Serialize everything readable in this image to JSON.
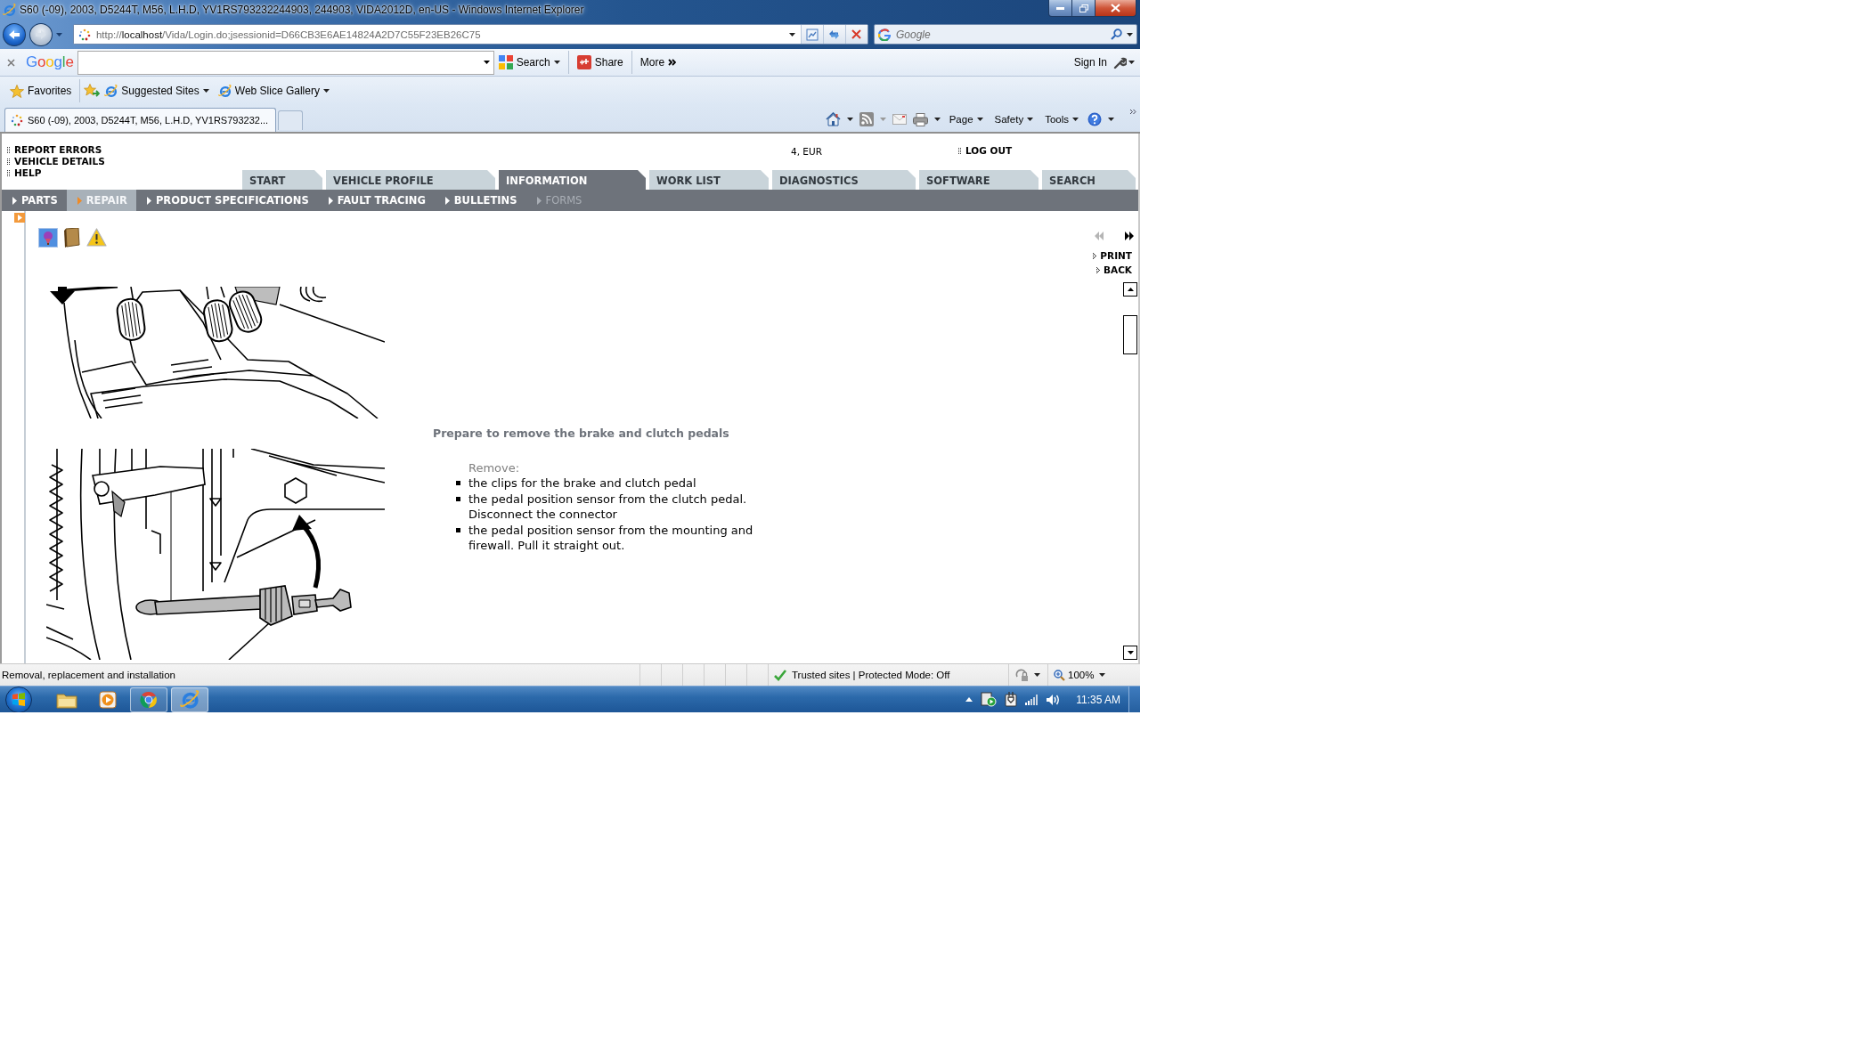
{
  "window": {
    "title": "S60 (-09), 2003, D5244T, M56, L.H.D, YV1RS793232244903, 244903, VIDA2012D, en-US - Windows Internet Explorer"
  },
  "address_bar": {
    "url": "http://**localhost**/Vida/Login.do;jsessionid=D66CB3E6AE14824A2D7C55F23EB26C75"
  },
  "search_box": {
    "placeholder": "Google"
  },
  "google_toolbar": {
    "logo": "Google",
    "buttons": [
      {
        "kind": "search",
        "label": "Search"
      },
      {
        "kind": "share",
        "label": "Share"
      },
      {
        "kind": "more",
        "label": "More"
      }
    ],
    "sign_in": "Sign In"
  },
  "favorites_bar": {
    "favorites": "Favorites",
    "links": [
      "Suggested Sites",
      "Web Slice Gallery"
    ]
  },
  "browser_tabs": [
    {
      "title": "S60 (-09), 2003, D5244T, M56, L.H.D, YV1RS793232...",
      "selected": true
    }
  ],
  "command_bar": {
    "menus": [
      "Page",
      "Safety",
      "Tools"
    ]
  },
  "app": {
    "top_links": [
      "REPORT ERRORS",
      "VEHICLE DETAILS",
      "HELP"
    ],
    "account": "4, EUR",
    "logout": "LOG OUT",
    "tabs": [
      {
        "label": "START",
        "selected": false
      },
      {
        "label": "VEHICLE PROFILE",
        "selected": false
      },
      {
        "label": "INFORMATION",
        "selected": true
      },
      {
        "label": "WORK LIST",
        "selected": false
      },
      {
        "label": "DIAGNOSTICS",
        "selected": false
      },
      {
        "label": "SOFTWARE",
        "selected": false
      },
      {
        "label": "SEARCH",
        "selected": false
      }
    ],
    "sub_tabs": [
      {
        "label": "PARTS",
        "selected": false,
        "disabled": false
      },
      {
        "label": "REPAIR",
        "selected": true,
        "disabled": false
      },
      {
        "label": "PRODUCT SPECIFICATIONS",
        "selected": false,
        "disabled": false
      },
      {
        "label": "FAULT TRACING",
        "selected": false,
        "disabled": false
      },
      {
        "label": "BULLETINS",
        "selected": false,
        "disabled": false
      },
      {
        "label": "FORMS",
        "selected": false,
        "disabled": true
      }
    ],
    "document": {
      "pager": [
        {
          "kind": "previous",
          "disabled": true
        },
        {
          "kind": "next",
          "disabled": false
        }
      ],
      "actions": [
        "PRINT",
        "BACK"
      ],
      "heading": "Prepare to remove the brake and clutch pedals",
      "intro": "Remove:",
      "steps": [
        "the clips for the brake and clutch pedal",
        "the pedal position sensor from the clutch pedal. Disconnect the connector",
        "the pedal position sensor from the mounting and firewall. Pull it straight out."
      ]
    }
  },
  "status_bar": {
    "text": "Removal, replacement and installation",
    "zone": "Trusted sites | Protected Mode: Off",
    "zoom": "100%"
  },
  "taskbar": {
    "apps": [
      {
        "kind": "folder",
        "running": false,
        "selected": false
      },
      {
        "kind": "media",
        "running": false,
        "selected": false
      },
      {
        "kind": "chrome",
        "running": true,
        "selected": false
      },
      {
        "kind": "ie",
        "running": true,
        "selected": true
      }
    ],
    "clock": "11:35 AM"
  }
}
